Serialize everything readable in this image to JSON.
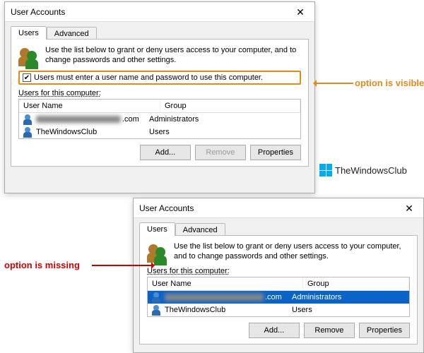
{
  "dialog1": {
    "title": "User Accounts",
    "close_glyph": "✕",
    "tabs": {
      "users": "Users",
      "advanced": "Advanced"
    },
    "intro": "Use the list below to grant or deny users access to your computer, and to change passwords and other settings.",
    "checkbox_label": "Users must enter a user name and password to use this computer.",
    "list_label": "Users for this computer:",
    "columns": {
      "name": "User Name",
      "group": "Group"
    },
    "rows": [
      {
        "name_suffix": ".com",
        "group": "Administrators"
      },
      {
        "name": "TheWindowsClub",
        "group": "Users"
      }
    ],
    "buttons": {
      "add": "Add...",
      "remove": "Remove",
      "props": "Properties"
    }
  },
  "dialog2": {
    "title": "User Accounts",
    "close_glyph": "✕",
    "tabs": {
      "users": "Users",
      "advanced": "Advanced"
    },
    "intro": "Use the list below to grant or deny users access to your computer, and to change passwords and other settings.",
    "list_label": "Users for this computer:",
    "columns": {
      "name": "User Name",
      "group": "Group"
    },
    "rows": [
      {
        "name_suffix": ".com",
        "group": "Administrators"
      },
      {
        "name": "TheWindowsClub",
        "group": "Users"
      }
    ],
    "buttons": {
      "add": "Add...",
      "remove": "Remove",
      "props": "Properties"
    }
  },
  "annotations": {
    "visible": "option is visible",
    "missing": "option is missing"
  },
  "watermark": "TheWindowsClub"
}
